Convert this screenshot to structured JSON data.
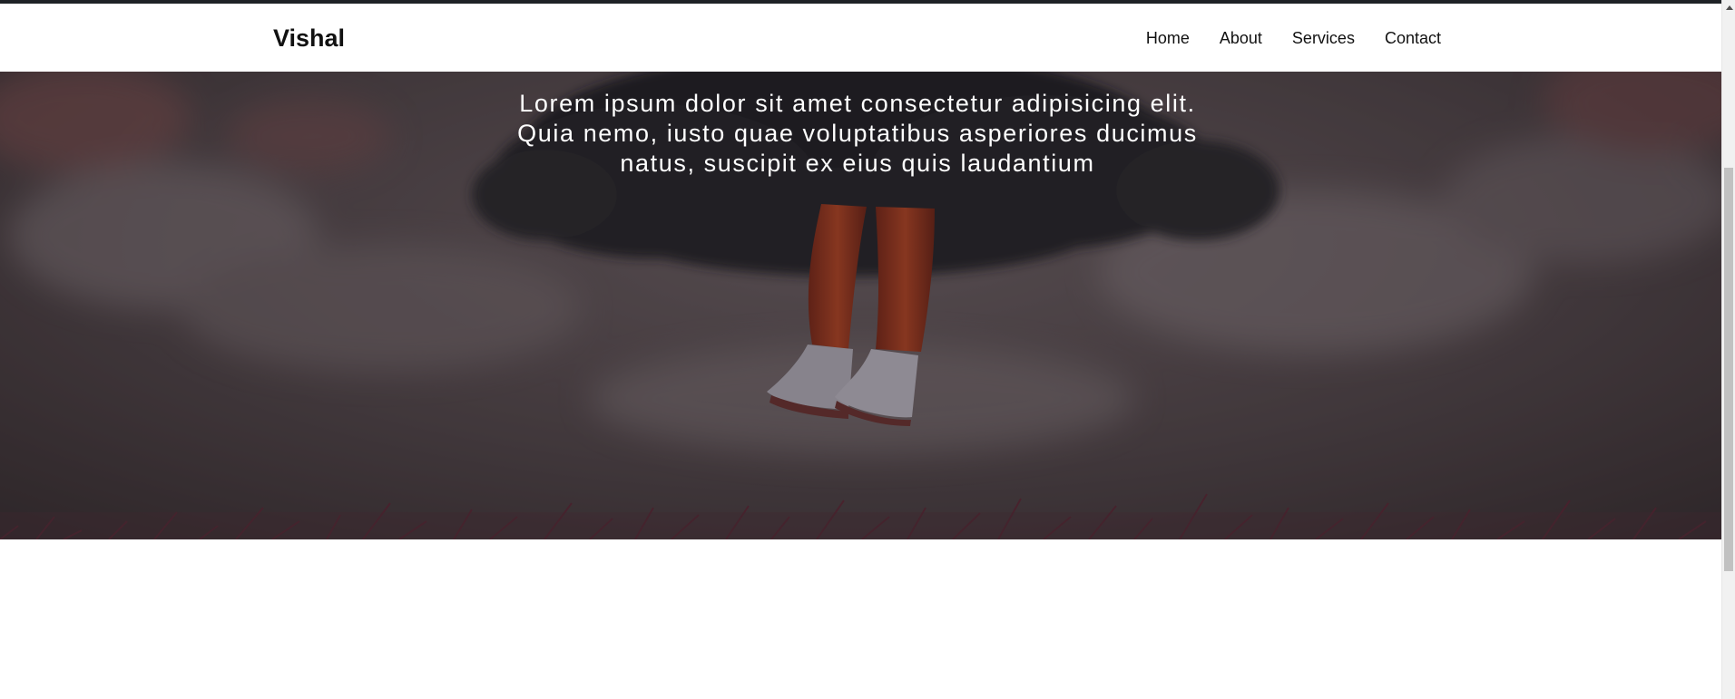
{
  "brand": {
    "name": "Vishal"
  },
  "nav": {
    "items": [
      {
        "label": "Home"
      },
      {
        "label": "About"
      },
      {
        "label": "Services"
      },
      {
        "label": "Contact"
      }
    ]
  },
  "hero": {
    "text": "Lorem ipsum dolor sit amet consectetur adipisicing elit. Quia nemo, iusto quae voluptatibus asperiores ducimus natus, suscipit ex eius quis laudantium",
    "background_image": "person-under-cloud-photo"
  },
  "colors": {
    "navbar_background": "#ffffff",
    "text_dark": "#111111",
    "hero_overlay": "#2b2528",
    "hero_text": "#ffffff"
  }
}
